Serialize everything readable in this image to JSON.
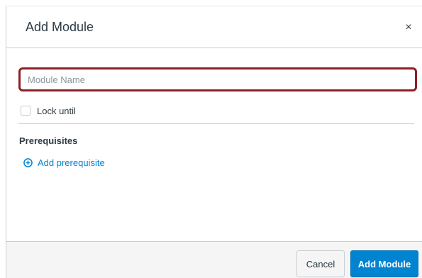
{
  "dialog": {
    "title": "Add Module",
    "close_icon": "close-icon",
    "close_symbol": "×"
  },
  "form": {
    "module_name": {
      "value": "",
      "placeholder": "Module Name"
    },
    "lock_until": {
      "label": "Lock until",
      "checked": false
    },
    "prerequisites": {
      "heading": "Prerequisites",
      "add_label": "Add prerequisite",
      "add_icon": "plus-circle-icon"
    }
  },
  "footer": {
    "cancel_label": "Cancel",
    "submit_label": "Add Module"
  },
  "colors": {
    "accent": "#0084d1",
    "focus_border": "#8e1f26",
    "footer_bg": "#f5f5f5",
    "text": "#2d3b45"
  }
}
